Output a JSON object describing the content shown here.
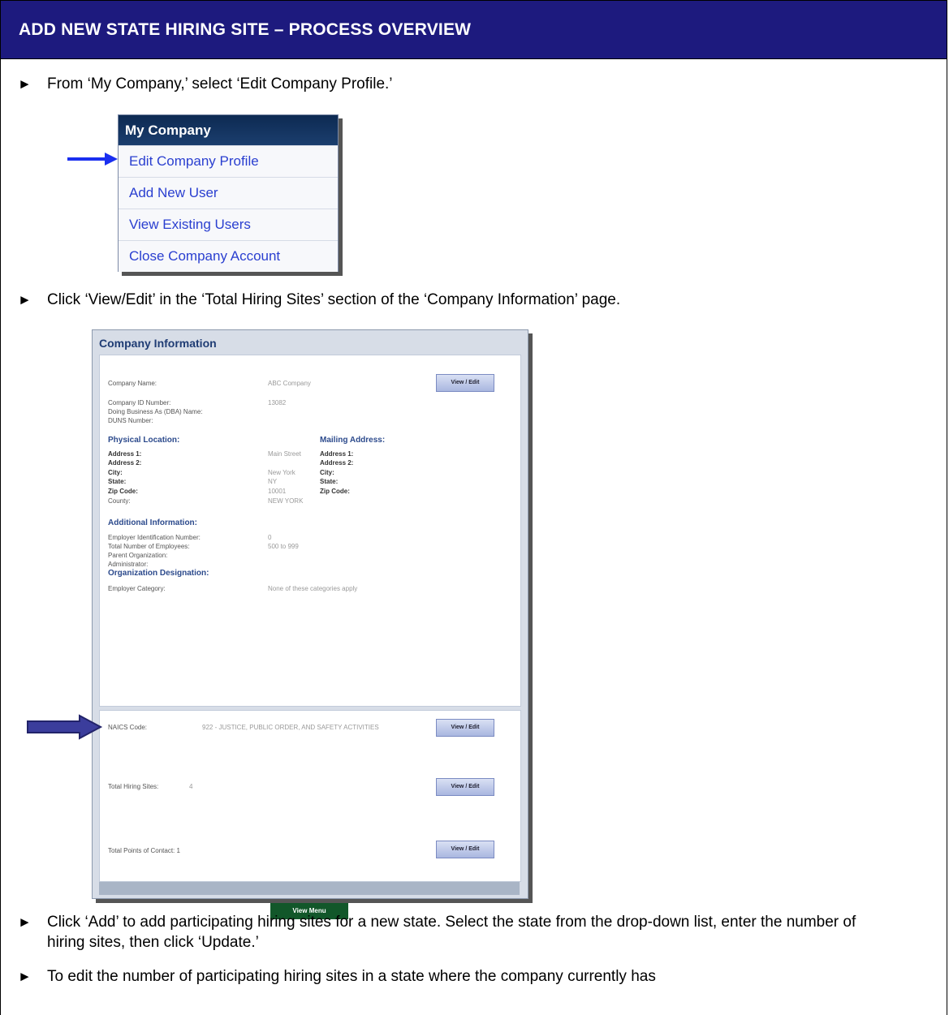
{
  "header": {
    "title": "ADD NEW STATE HIRING SITE – PROCESS OVERVIEW"
  },
  "bullet_glyph": "►",
  "steps": [
    {
      "text": "From ‘My Company,’ select ‘Edit Company Profile.’"
    },
    {
      "text": "Click ‘View/Edit’ in the ‘Total Hiring Sites’ section of the ‘Company Information’ page."
    },
    {
      "text": "Click ‘Add’ to add participating hiring sites for a new state. Select the state from the drop-down list, enter the number of hiring sites, then click ‘Update.’"
    },
    {
      "text": "To edit the number of participating hiring sites in a state where the company currently has"
    }
  ],
  "menu": {
    "title": "My Company",
    "items": [
      "Edit Company Profile",
      "Add New User",
      "View Existing Users",
      "Close Company Account"
    ]
  },
  "company_info": {
    "title": "Company Information",
    "company_name_label": "Company Name:",
    "company_name_value": "ABC Company",
    "company_id_label": "Company ID Number:",
    "company_id_value": "13082",
    "dba_label": "Doing Business As (DBA) Name:",
    "duns_label": "DUNS Number:",
    "physical_heading": "Physical Location:",
    "mailing_heading": "Mailing Address:",
    "address1_label": "Address 1:",
    "address1_value": "Main Street",
    "address2_label": "Address 2:",
    "city_label": "City:",
    "city_value": "New York",
    "state_label": "State:",
    "state_value": "NY",
    "zip_label": "Zip Code:",
    "zip_value": "10001",
    "county_label": "County:",
    "county_value": "NEW YORK",
    "additional_heading": "Additional Information:",
    "ein_label": "Employer Identification Number:",
    "ein_value": "0",
    "employees_label": "Total Number of Employees:",
    "employees_value": "500 to 999",
    "parent_label": "Parent Organization:",
    "admin_label": "Administrator:",
    "org_heading": "Organization Designation:",
    "category_label": "Employer Category:",
    "category_value": "None of these categories apply",
    "naics_label": "NAICS Code:",
    "naics_value": "922 - JUSTICE, PUBLIC ORDER, AND SAFETY ACTIVITIES",
    "hiring_label": "Total Hiring Sites:",
    "hiring_value": "4",
    "contacts_label": "Total Points of Contact: 1",
    "view_edit": "View / Edit",
    "view_menu": "View Menu"
  }
}
